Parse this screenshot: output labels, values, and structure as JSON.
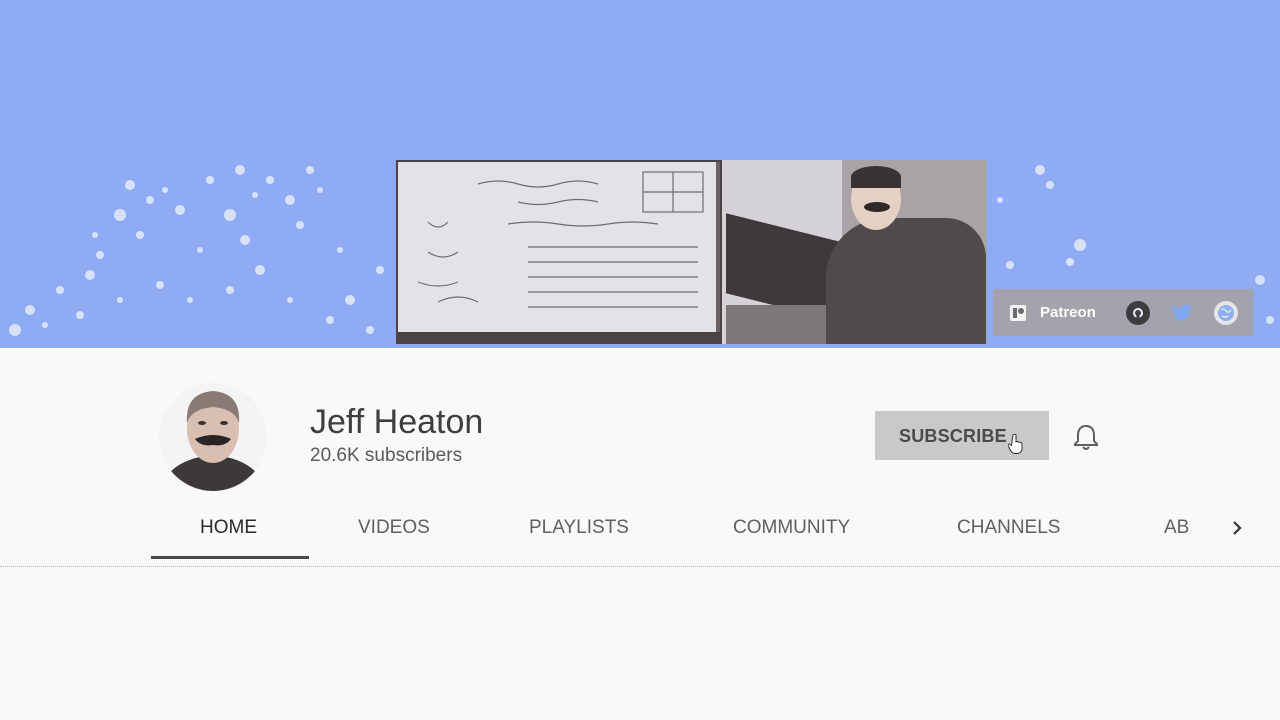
{
  "banner": {
    "background_color": "#8fabf4",
    "links": {
      "patreon_label": "Patreon",
      "icons": [
        "patreon-icon",
        "github-icon",
        "twitter-icon",
        "web-icon"
      ]
    }
  },
  "channel": {
    "name": "Jeff Heaton",
    "subscribers": "20.6K subscribers",
    "subscribe_label": "SUBSCRIBE",
    "bell_icon": "bell-icon"
  },
  "tabs": [
    {
      "label": "HOME",
      "active": true
    },
    {
      "label": "VIDEOS",
      "active": false
    },
    {
      "label": "PLAYLISTS",
      "active": false
    },
    {
      "label": "COMMUNITY",
      "active": false
    },
    {
      "label": "CHANNELS",
      "active": false
    },
    {
      "label": "AB",
      "active": false
    }
  ],
  "tabs_scroll_icon": "chevron-right-icon",
  "colors": {
    "banner": "#8fabf4",
    "page_bg": "#f9f9f9",
    "subscribe_bg": "#c9c9c9",
    "links_bar": "#a3a3ad"
  }
}
